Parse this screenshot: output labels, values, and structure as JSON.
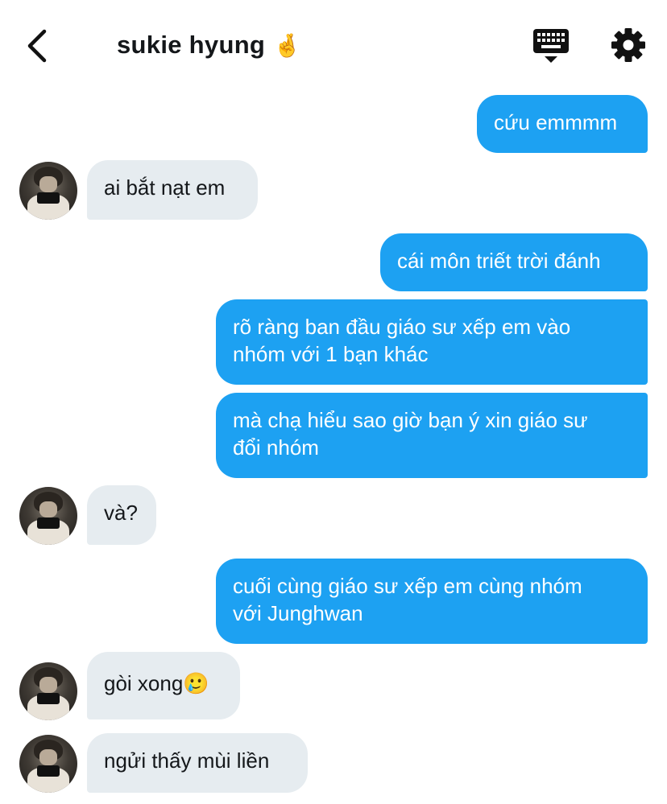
{
  "header": {
    "title": "sukie hyung",
    "title_emoji": "🤞",
    "back_icon": "chevron-left-icon",
    "keyboard_icon": "keyboard-icon",
    "settings_icon": "gear-icon"
  },
  "colors": {
    "outgoing_bubble": "#1da1f2",
    "incoming_bubble": "#e6ecf0",
    "text_dark": "#14171a"
  },
  "messages": [
    {
      "from": "me",
      "text": "cứu emmmm"
    },
    {
      "from": "them",
      "text": "ai bắt nạt em"
    },
    {
      "from": "me",
      "text": "cái môn triết trời đánh"
    },
    {
      "from": "me",
      "text": "rõ ràng ban đầu giáo sư xếp em vào\nnhóm với 1 bạn khác"
    },
    {
      "from": "me",
      "text": "mà chạ hiểu sao giờ bạn ý xin giáo sư\nđổi nhóm"
    },
    {
      "from": "them",
      "text": "và?"
    },
    {
      "from": "me",
      "text": "cuối cùng giáo sư xếp em cùng nhóm\nvới Junghwan"
    },
    {
      "from": "them",
      "text": "gòi xong🥲"
    },
    {
      "from": "them",
      "text": "ngửi thấy mùi liền"
    }
  ]
}
